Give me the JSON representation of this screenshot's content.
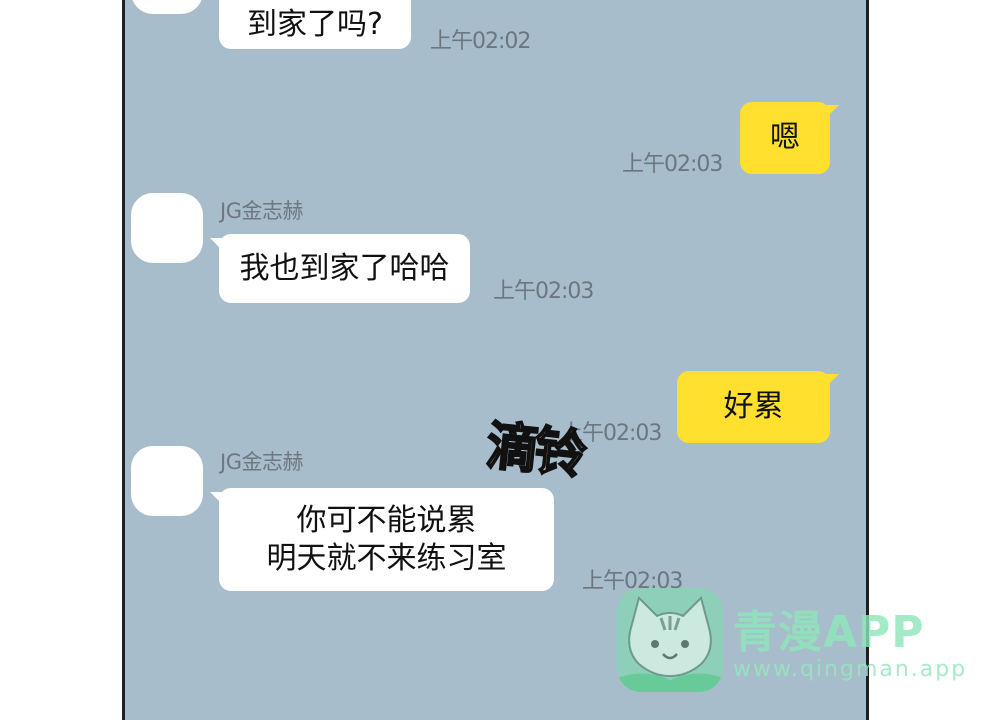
{
  "chat": {
    "messages": [
      {
        "side": "in",
        "text": "到家了吗?",
        "time": "上午02:02"
      },
      {
        "side": "out",
        "text": "嗯",
        "time": "上午02:03"
      },
      {
        "side": "in",
        "sender": "JG金志赫",
        "text": "我也到家了哈哈",
        "time": "上午02:03"
      },
      {
        "side": "out",
        "text": "好累",
        "time": "上午02:03"
      },
      {
        "side": "in",
        "sender": "JG金志赫",
        "lines": [
          "你可不能说累",
          "明天就不来练习室"
        ],
        "time": "上午02:03"
      }
    ]
  },
  "sound_effect": "滴铃",
  "watermark": {
    "title": "青漫APP",
    "url": "www.qingman.app",
    "icon": "cat-icon"
  },
  "colors": {
    "chat_background": "#a8bdcc",
    "incoming_bubble": "#ffffff",
    "outgoing_bubble": "#ffe02e",
    "timestamp": "#6c7680",
    "watermark": "#8ce6b9"
  }
}
